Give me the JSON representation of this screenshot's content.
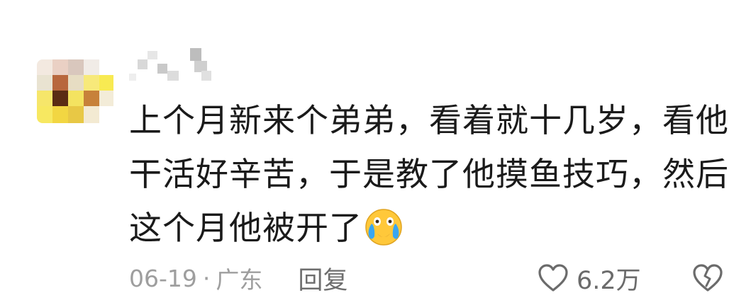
{
  "comment": {
    "lines": [
      "上个月新来个弟弟，看着就十几岁，看他",
      "干活好辛苦，于是教了他摸鱼技巧，然后",
      "这个月他被开了"
    ],
    "emoji": "crying-laughing-emoji"
  },
  "meta": {
    "date": "06-19",
    "separator": "·",
    "location": "广东",
    "reply_label": "回复"
  },
  "actions": {
    "like_count": "6.2万",
    "like_icon": "heart-outline-icon",
    "dislike_icon": "broken-heart-icon"
  },
  "colors": {
    "text": "#1a1a1a",
    "meta": "#9e9e9e",
    "icon": "#6b6b6b",
    "emoji_face": "#ffc83a"
  }
}
